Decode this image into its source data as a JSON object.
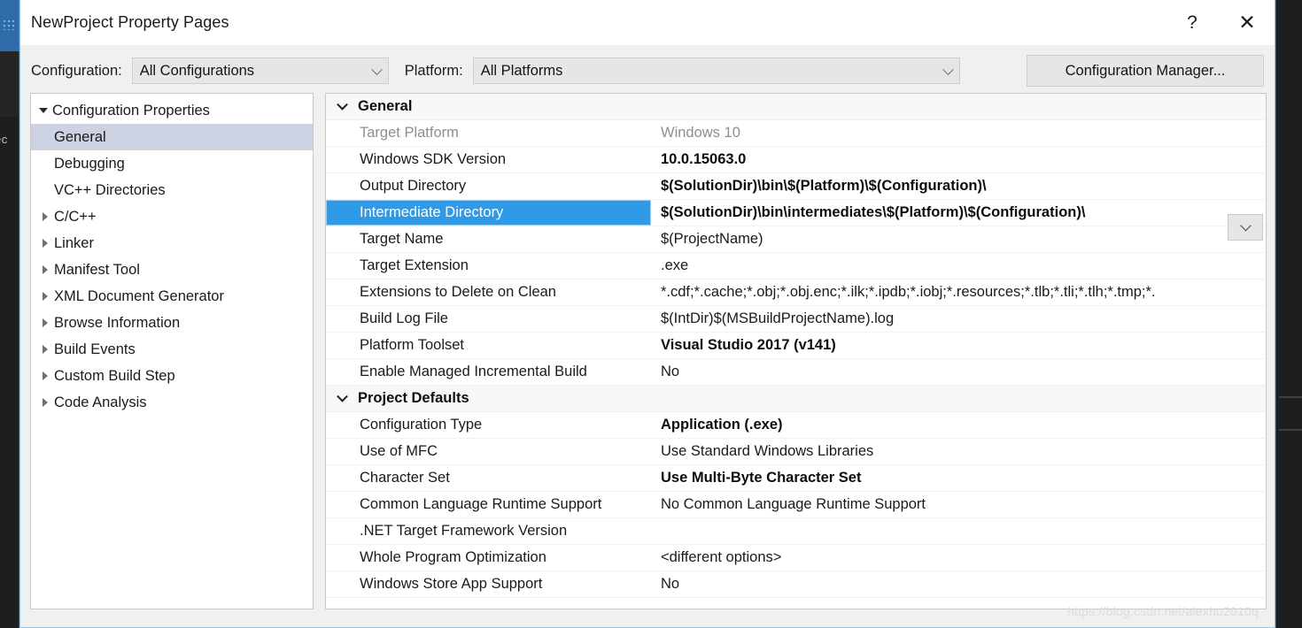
{
  "window": {
    "title": "NewProject Property Pages",
    "help_label": "?",
    "close_label": "✕"
  },
  "toolbar": {
    "configuration_label": "Configuration:",
    "configuration_value": "All Configurations",
    "platform_label": "Platform:",
    "platform_value": "All Platforms",
    "configuration_manager_label": "Configuration Manager..."
  },
  "tree": {
    "items": [
      {
        "label": "Configuration Properties",
        "level": 0,
        "twisty": "down",
        "selected": false
      },
      {
        "label": "General",
        "level": 1,
        "twisty": "none",
        "selected": true
      },
      {
        "label": "Debugging",
        "level": 1,
        "twisty": "none",
        "selected": false
      },
      {
        "label": "VC++ Directories",
        "level": 1,
        "twisty": "none",
        "selected": false
      },
      {
        "label": "C/C++",
        "level": 1,
        "twisty": "right",
        "selected": false
      },
      {
        "label": "Linker",
        "level": 1,
        "twisty": "right",
        "selected": false
      },
      {
        "label": "Manifest Tool",
        "level": 1,
        "twisty": "right",
        "selected": false
      },
      {
        "label": "XML Document Generator",
        "level": 1,
        "twisty": "right",
        "selected": false
      },
      {
        "label": "Browse Information",
        "level": 1,
        "twisty": "right",
        "selected": false
      },
      {
        "label": "Build Events",
        "level": 1,
        "twisty": "right",
        "selected": false
      },
      {
        "label": "Custom Build Step",
        "level": 1,
        "twisty": "right",
        "selected": false
      },
      {
        "label": "Code Analysis",
        "level": 1,
        "twisty": "right",
        "selected": false
      }
    ]
  },
  "grid": {
    "sections": [
      {
        "title": "General",
        "expanded": true,
        "rows": [
          {
            "name": "Target Platform",
            "value": "Windows 10",
            "style": "dim"
          },
          {
            "name": "Windows SDK Version",
            "value": "10.0.15063.0",
            "style": "bold"
          },
          {
            "name": "Output Directory",
            "value": "$(SolutionDir)\\bin\\$(Platform)\\$(Configuration)\\",
            "style": "bold"
          },
          {
            "name": "Intermediate Directory",
            "value": "$(SolutionDir)\\bin\\intermediates\\$(Platform)\\$(Configuration)\\",
            "style": "selected"
          },
          {
            "name": "Target Name",
            "value": "$(ProjectName)",
            "style": "normal"
          },
          {
            "name": "Target Extension",
            "value": ".exe",
            "style": "normal"
          },
          {
            "name": "Extensions to Delete on Clean",
            "value": "*.cdf;*.cache;*.obj;*.obj.enc;*.ilk;*.ipdb;*.iobj;*.resources;*.tlb;*.tli;*.tlh;*.tmp;*.",
            "style": "normal"
          },
          {
            "name": "Build Log File",
            "value": "$(IntDir)$(MSBuildProjectName).log",
            "style": "normal"
          },
          {
            "name": "Platform Toolset",
            "value": "Visual Studio 2017 (v141)",
            "style": "bold"
          },
          {
            "name": "Enable Managed Incremental Build",
            "value": "No",
            "style": "normal"
          }
        ]
      },
      {
        "title": "Project Defaults",
        "expanded": true,
        "rows": [
          {
            "name": "Configuration Type",
            "value": "Application (.exe)",
            "style": "bold"
          },
          {
            "name": "Use of MFC",
            "value": "Use Standard Windows Libraries",
            "style": "normal"
          },
          {
            "name": "Character Set",
            "value": "Use Multi-Byte Character Set",
            "style": "bold"
          },
          {
            "name": "Common Language Runtime Support",
            "value": "No Common Language Runtime Support",
            "style": "normal"
          },
          {
            "name": ".NET Target Framework Version",
            "value": "",
            "style": "normal"
          },
          {
            "name": "Whole Program Optimization",
            "value": "<different options>",
            "style": "normal"
          },
          {
            "name": "Windows Store App Support",
            "value": "No",
            "style": "normal"
          }
        ]
      }
    ],
    "selected_row_dropdown_icon": "chevron-down-icon"
  },
  "watermark": "https://blog.csdn.net/alexhu2010q",
  "colors": {
    "selection_blue": "#2f9ae8",
    "tree_selection": "#cdd2e3",
    "dialog_border": "#8fc5e8",
    "shell_dark": "#1e1e1e",
    "accent_blue": "#2d6ca8"
  }
}
